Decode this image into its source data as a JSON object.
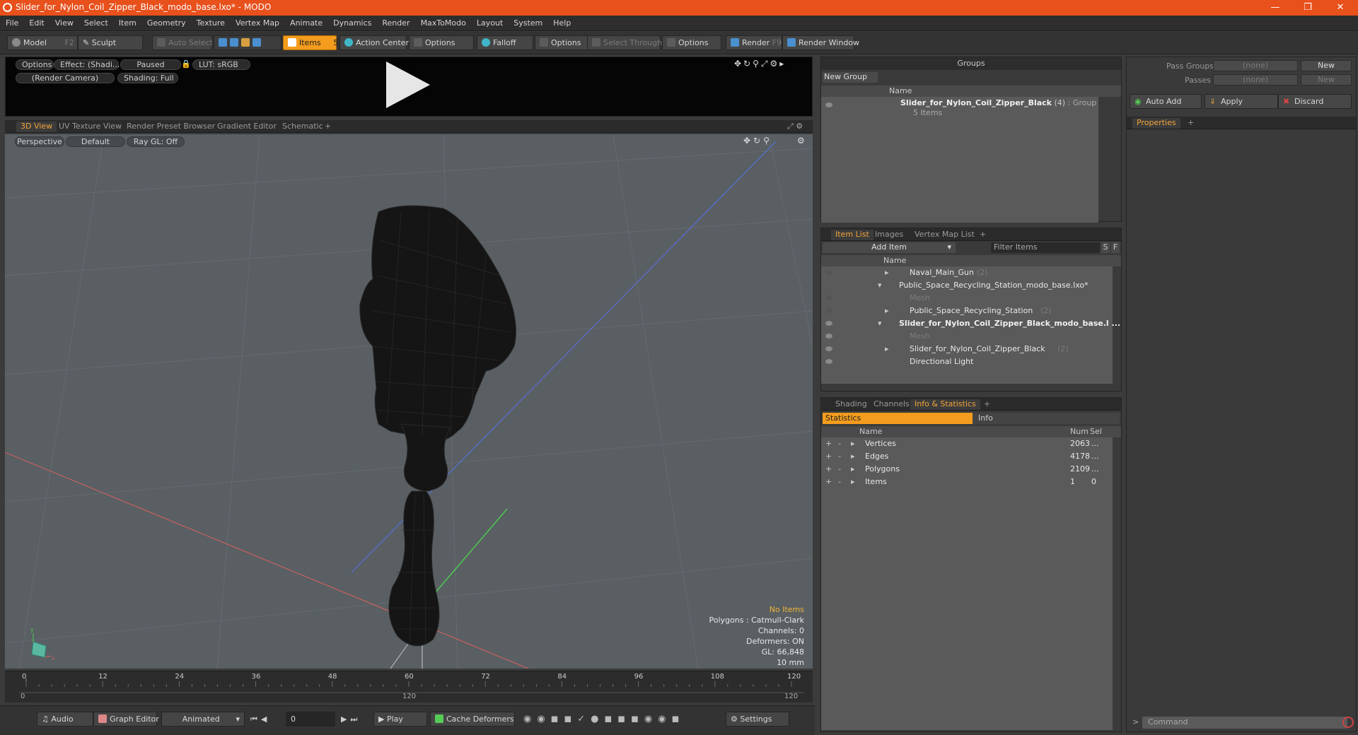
{
  "window": {
    "title": "Slider_for_Nylon_Coil_Zipper_Black_modo_base.lxo* - MODO"
  },
  "menu": [
    "File",
    "Edit",
    "View",
    "Select",
    "Item",
    "Geometry",
    "Texture",
    "Vertex Map",
    "Animate",
    "Dynamics",
    "Render",
    "MaxToModo",
    "Layout",
    "System",
    "Help"
  ],
  "toolbar": {
    "model": "Model",
    "model_key": "F2",
    "sculpt": "Sculpt",
    "auto_select": "Auto Select",
    "items": "Items",
    "items_key": "5",
    "action_center": "Action Center",
    "options1": "Options",
    "falloff": "Falloff",
    "options2": "Options",
    "select_through": "Select Through",
    "options3": "Options",
    "render": "Render",
    "render_key": "F9",
    "render_window": "Render Window"
  },
  "preview": {
    "options": "Options",
    "effect": "Effect: (Shadi...",
    "paused": "Paused",
    "lut": "LUT: sRGB",
    "camera": "(Render Camera)",
    "shading": "Shading: Full"
  },
  "viewport_tabs": [
    "3D View",
    "UV Texture View",
    "Render Preset Browser",
    "Gradient Editor",
    "Schematic",
    "+"
  ],
  "viewport": {
    "perspective": "Perspective",
    "default": "Default",
    "raygl": "Ray GL: Off",
    "hud": {
      "no_items": "No Items",
      "polygons": "Polygons : Catmull-Clark",
      "channels": "Channels: 0",
      "deformers": "Deformers: ON",
      "gl": "GL: 66,848",
      "scale": "10 mm"
    }
  },
  "timeline": {
    "ticks": [
      "0",
      "12",
      "24",
      "36",
      "48",
      "60",
      "72",
      "84",
      "96",
      "108",
      "120"
    ],
    "start": "0",
    "mid": "120",
    "end": "120"
  },
  "bottombar": {
    "audio": "Audio",
    "graph_editor": "Graph Editor",
    "animated": "Animated",
    "frame": "0",
    "play": "Play",
    "cache_deformers": "Cache Deformers",
    "settings": "Settings"
  },
  "groups": {
    "title": "Groups",
    "new_group": "New Group",
    "col_name": "Name",
    "item_name": "Slider_for_Nylon_Coil_Zipper_Black",
    "item_count": "(4)",
    "item_type": ": Group",
    "item_sub": "5 Items"
  },
  "item_list": {
    "tabs": [
      "Item List",
      "Images",
      "Vertex Map List",
      "+"
    ],
    "add_item": "Add Item",
    "filter": "Filter Items",
    "s": "S",
    "f": "F",
    "col_name": "Name",
    "rows": [
      {
        "label": "Naval_Main_Gun",
        "count": "(2)"
      },
      {
        "label": "Public_Space_Recycling_Station_modo_base.lxo*",
        "count": ""
      },
      {
        "label": "Mesh",
        "count": ""
      },
      {
        "label": "Public_Space_Recycling_Station",
        "count": "(2)"
      },
      {
        "label": "Slider_for_Nylon_Coil_Zipper_Black_modo_base.l ...",
        "count": ""
      },
      {
        "label": "Mesh",
        "count": ""
      },
      {
        "label": "Slider_for_Nylon_Coil_Zipper_Black",
        "count": "(2)"
      },
      {
        "label": "Directional Light",
        "count": ""
      }
    ]
  },
  "stats_panel": {
    "tabs": [
      "Shading",
      "Channels",
      "Info & Statistics",
      "+"
    ],
    "subtabs": [
      "Statistics",
      "Info"
    ],
    "cols": [
      "Name",
      "Num",
      "Sel"
    ],
    "rows": [
      {
        "name": "Vertices",
        "num": "2063",
        "sel": "..."
      },
      {
        "name": "Edges",
        "num": "4178",
        "sel": "..."
      },
      {
        "name": "Polygons",
        "num": "2109",
        "sel": "..."
      },
      {
        "name": "Items",
        "num": "1",
        "sel": "0"
      }
    ]
  },
  "passes": {
    "pass_groups": "Pass Groups",
    "pass_groups_val": "(none)",
    "new": "New",
    "passes": "Passes",
    "passes_val": "(none)",
    "new2": "New",
    "auto_add": "Auto Add",
    "apply": "Apply",
    "discard": "Discard",
    "properties": "Properties",
    "plus": "+"
  },
  "command": {
    "placeholder": "Command"
  },
  "colors": {
    "accent": "#f39c1d",
    "titlebar": "#e8501c"
  }
}
